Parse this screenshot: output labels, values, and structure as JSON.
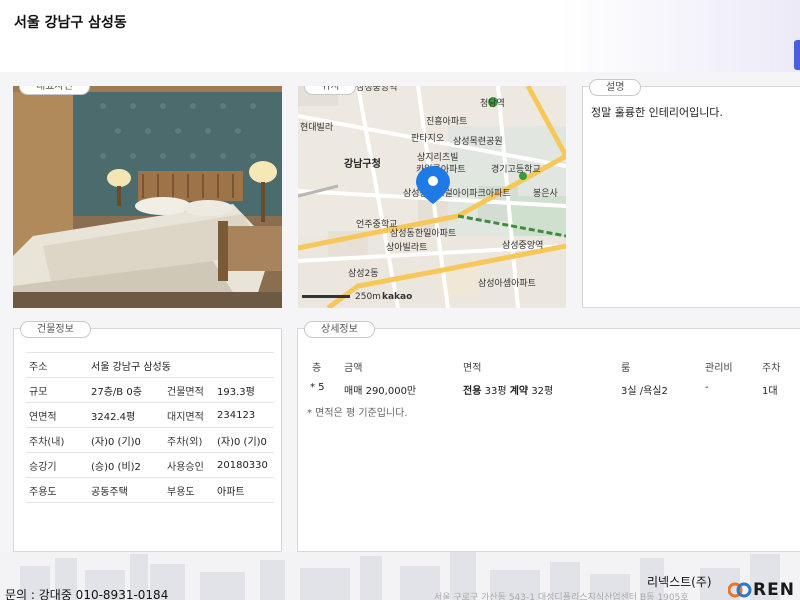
{
  "header": {
    "title": "서울 강남구 삼성동"
  },
  "photo_panel": {
    "label": "대표사진"
  },
  "map_panel": {
    "label": "위치",
    "places": [
      "삼성중앙역",
      "청담역",
      "진흥아파트",
      "현대빌라",
      "판타지오",
      "삼성목련공원",
      "강남구청",
      "상지리츠빌",
      "카일룸아파트",
      "경기고등학교",
      "봉은사",
      "삼성동센트럴아이파크아파트",
      "언주중학교",
      "삼성동한일아파트",
      "상아빌라트",
      "삼성아셈아파트",
      "삼성2동"
    ],
    "scale": "250m",
    "brand": "kakao"
  },
  "description_panel": {
    "label": "설명",
    "text": "정말 훌륭한 인테리어입니다."
  },
  "building_panel": {
    "label": "건물정보",
    "rows": [
      {
        "k1": "주소",
        "v1": "서울 강남구 삼성동",
        "k2": "",
        "v2": ""
      },
      {
        "k1": "규모",
        "v1": "27층/B 0층",
        "k2": "건물면적",
        "v2": "193.3평"
      },
      {
        "k1": "연면적",
        "v1": "3242.4평",
        "k2": "대지면적",
        "v2": "234123"
      },
      {
        "k1": "주차(내)",
        "v1": "(자)0 (기)0",
        "k2": "주차(외)",
        "v2": "(자)0 (기)0"
      },
      {
        "k1": "승강기",
        "v1": "(승)0 (비)2",
        "k2": "사용승인",
        "v2": "20180330"
      },
      {
        "k1": "주용도",
        "v1": "공동주택",
        "k2": "부용도",
        "v2": "아파트"
      }
    ]
  },
  "detail_panel": {
    "label": "상세정보",
    "headers": {
      "floor": "층",
      "price": "금액",
      "area": "면적",
      "rooms": "룸",
      "fee": "관리비",
      "parking": "주차"
    },
    "row": {
      "floor": "* 5",
      "price": "매매 290,000만",
      "area_excl_label": "전용",
      "area_excl": "33평",
      "area_contract_label": "계약",
      "area_contract": "32평",
      "rooms": "3실 /욕실2",
      "fee": "-",
      "parking": "1대"
    },
    "note": "* 면적은 평 기준입니다."
  },
  "footer": {
    "contact": "문의 : 강대중 010-8931-0184",
    "company": "리넥스트(주)",
    "address": "서울 구로구 가산동 543-1 대성디폴리스지식산업센터 B동 1905호",
    "logo": "REN"
  },
  "colors": {
    "accent": "#4a5fe0",
    "map_marker": "#1e7be6",
    "map_road": "#f6c85a"
  }
}
